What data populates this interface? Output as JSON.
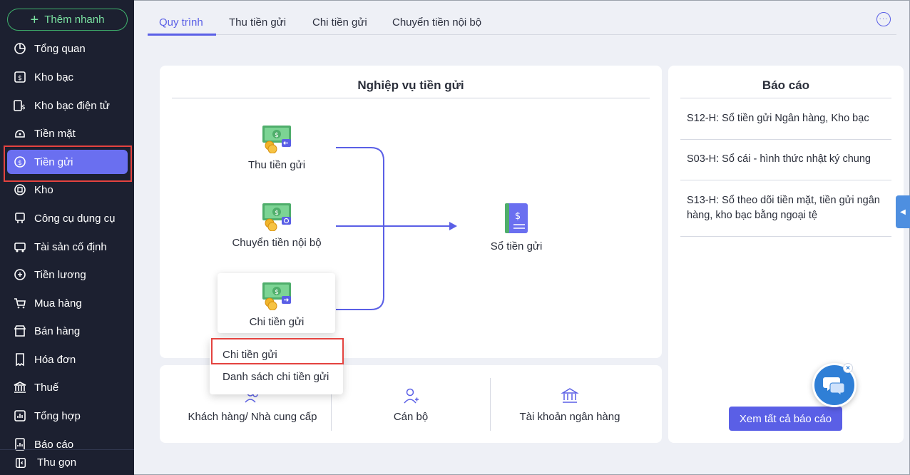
{
  "sidebar": {
    "quick_add_label": "Thêm nhanh",
    "items": [
      {
        "label": "Tổng quan",
        "icon": "pie-chart-icon"
      },
      {
        "label": "Kho bạc",
        "icon": "treasury-icon"
      },
      {
        "label": "Kho bạc điện tử",
        "icon": "e-treasury-icon"
      },
      {
        "label": "Tiền mặt",
        "icon": "cash-icon"
      },
      {
        "label": "Tiền gửi",
        "icon": "deposit-icon",
        "active": true
      },
      {
        "label": "Kho",
        "icon": "warehouse-icon"
      },
      {
        "label": "Công cụ dụng cụ",
        "icon": "tools-icon"
      },
      {
        "label": "Tài sản cố định",
        "icon": "fixed-asset-icon"
      },
      {
        "label": "Tiền lương",
        "icon": "salary-icon"
      },
      {
        "label": "Mua hàng",
        "icon": "cart-icon"
      },
      {
        "label": "Bán hàng",
        "icon": "store-icon"
      },
      {
        "label": "Hóa đơn",
        "icon": "invoice-icon"
      },
      {
        "label": "Thuế",
        "icon": "tax-icon"
      },
      {
        "label": "Tổng hợp",
        "icon": "summary-icon"
      },
      {
        "label": "Báo cáo",
        "icon": "report-icon"
      }
    ],
    "collapse_label": "Thu gọn"
  },
  "tabs": [
    {
      "label": "Quy trình",
      "active": true
    },
    {
      "label": "Thu tiền gửi"
    },
    {
      "label": "Chi tiền gửi"
    },
    {
      "label": "Chuyển tiền nội bộ"
    }
  ],
  "process": {
    "title": "Nghiệp vụ tiền gửi",
    "nodes": {
      "receive": "Thu tiền gửi",
      "transfer": "Chuyển tiền nội bộ",
      "pay": "Chi tiền gửi",
      "ledger": "Sổ tiền gửi"
    },
    "dropdown": {
      "item1": "Chi tiền gửi",
      "item2": "Danh sách chi tiền gửi"
    }
  },
  "catalog": {
    "customers": "Khách hàng/ Nhà cung cấp",
    "staff": "Cán bộ",
    "bank_accounts": "Tài khoản ngân hàng"
  },
  "reports": {
    "title": "Báo cáo",
    "items": [
      "S12-H: Sổ tiền gửi Ngân hàng, Kho bạc",
      "S03-H: Sổ cái - hình thức nhật ký chung",
      "S13-H: Sổ theo dõi tiền mặt, tiền gửi ngân hàng, kho bạc bằng ngoại tệ"
    ],
    "see_all": "Xem tất cả báo cáo"
  },
  "colors": {
    "sidebar_bg": "#1c2030",
    "accent": "#5a5fe6",
    "active_item": "#6a6ff0",
    "highlight_box": "#e4433f",
    "quick_add": "#3fb36d"
  }
}
